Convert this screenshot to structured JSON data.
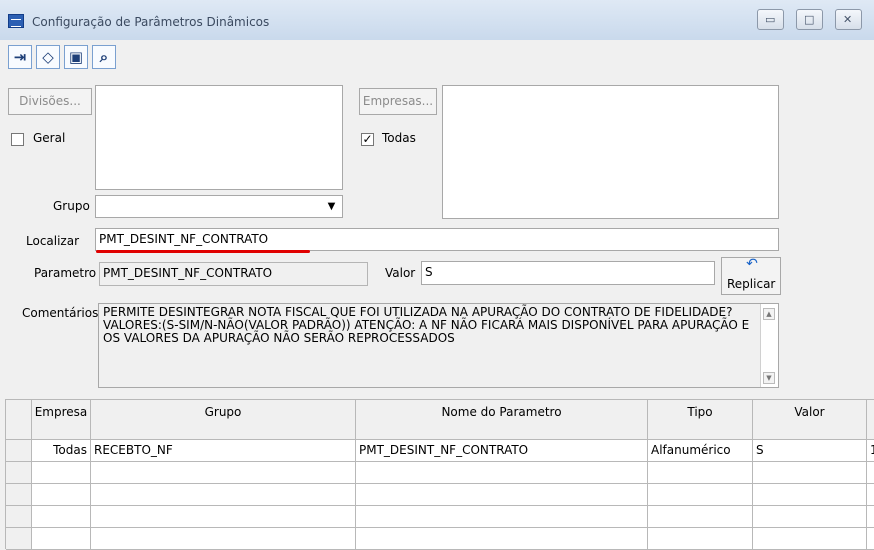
{
  "window": {
    "title": "Configuração de Parâmetros Dinâmicos",
    "controls": [
      "minimize",
      "maximize",
      "close"
    ]
  },
  "toolbar": {
    "buttons": [
      {
        "icon": "exit-icon"
      },
      {
        "icon": "eraser-icon"
      },
      {
        "icon": "folder-check-icon"
      },
      {
        "icon": "search-icon"
      }
    ]
  },
  "filters": {
    "divisoes_button": "Divisões...",
    "geral_label": "Geral",
    "empresas_button": "Empresas...",
    "todas_label": "Todas",
    "todas_checked": true,
    "grupo_label": "Grupo",
    "grupo_value": "",
    "localizar_label": "Localizar",
    "localizar_value": "PMT_DESINT_NF_CONTRATO"
  },
  "details": {
    "parametro_label": "Parametro",
    "parametro_value": "PMT_DESINT_NF_CONTRATO",
    "valor_label": "Valor",
    "valor_value": "S",
    "replicar_label": "Replicar",
    "comentarios_label": "Comentários",
    "comentarios_text": "PERMITE DESINTEGRAR NOTA FISCAL QUE FOI UTILIZADA NA APURAÇÃO DO CONTRATO DE FIDELIDADE? VALORES:(S-SIM/N-NÃO(VALOR PADRÃO)) ATENÇÃO: A NF NÃO FICARÁ MAIS DISPONÍVEL PARA APURAÇÃO E OS VALORES DA APURAÇÃO NÃO SERÃO REPROCESSADOS"
  },
  "table": {
    "columns": [
      "Empresa",
      "Grupo",
      "Nome do Parametro",
      "Tipo",
      "Valor"
    ],
    "rows": [
      [
        "Todas",
        "RECEBTO_NF",
        "PMT_DESINT_NF_CONTRATO",
        "Alfanumérico",
        "S"
      ]
    ],
    "overflow_cell": "1"
  },
  "colors": {
    "accent": "#e00000",
    "window_title": "#3b4a60"
  }
}
